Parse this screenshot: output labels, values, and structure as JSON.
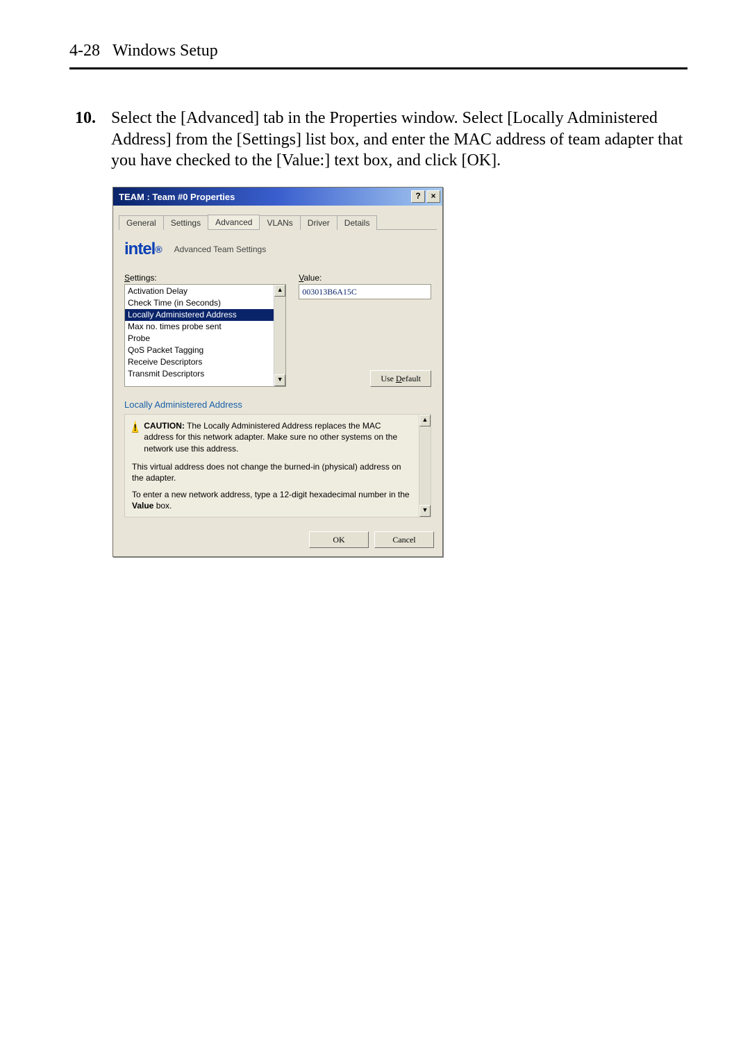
{
  "header": {
    "page_label": "4-28",
    "section": "Windows Setup"
  },
  "step": {
    "number": "10.",
    "text": "Select the [Advanced] tab in the Properties window. Select [Locally Administered Address] from the [Settings] list box, and enter the MAC address of team adapter that you have checked to the [Value:] text box, and click [OK]."
  },
  "dialog": {
    "title": "TEAM : Team #0 Properties",
    "sys_help": "?",
    "sys_close": "×",
    "tabs": [
      "General",
      "Settings",
      "Advanced",
      "VLANs",
      "Driver",
      "Details"
    ],
    "brand": "intel",
    "brand_dot": "®",
    "subtitle": "Advanced Team Settings",
    "settings_label_pre": "S",
    "settings_label_rest": "ettings:",
    "value_label_pre": "V",
    "value_label_rest": "alue:",
    "settings_items": [
      "Activation Delay",
      "Check Time (in Seconds)",
      "Locally Administered Address",
      "Max no. times probe sent",
      "Probe",
      "QoS Packet Tagging",
      "Receive Descriptors",
      "Transmit Descriptors"
    ],
    "selected_index": 2,
    "value_text": "003013B6A15C",
    "use_default_label": "Use Default",
    "use_default_ul": "D",
    "section_name": "Locally Administered Address",
    "caution_bold": "CAUTION:",
    "caution_rest": " The Locally Administered Address replaces the MAC address for this network adapter.  Make sure no other systems on the network use this address.",
    "para2": "This virtual address does not change the burned-in (physical) address on the adapter.",
    "para3_a": "To enter a new network address, type a 12-digit hexadecimal number in the ",
    "para3_b": "Value",
    "para3_c": " box.",
    "ok_label": "OK",
    "cancel_label": "Cancel"
  }
}
